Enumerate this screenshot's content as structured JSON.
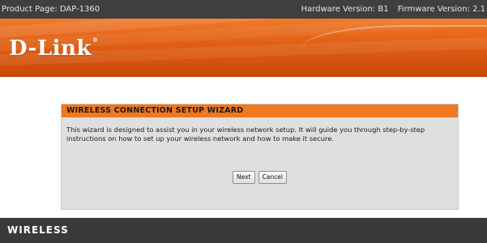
{
  "topbar": {
    "product": "Product Page: DAP-1360",
    "hardware": "Hardware Version: B1",
    "firmware": "Firmware Version: 2.1"
  },
  "header": {
    "logo_text": "D-Link",
    "logo_mark": "®"
  },
  "wizard": {
    "title": "WIRELESS CONNECTION SETUP WIZARD",
    "description_line1": "This wizard is designed to assist you in your wireless network setup. It will guide you through step-by-step",
    "description_line2": "instructions on how to set up your wireless network and how to make it secure.",
    "next_label": "Next",
    "cancel_label": "Cancel"
  },
  "footer": {
    "label": "WIRELESS"
  },
  "colors": {
    "topbar_bg": "#3f3f3f",
    "banner_orange": "#e05e14",
    "wizard_title_bg": "#f0781e",
    "wizard_bg": "#dfdfdf",
    "footer_bg": "#3a3a3a"
  }
}
